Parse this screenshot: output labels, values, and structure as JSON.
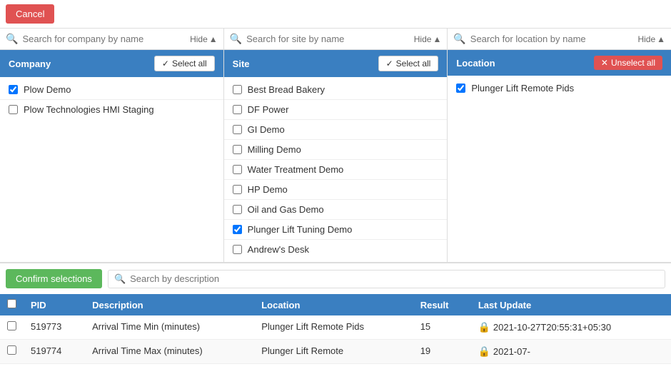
{
  "cancelButton": "Cancel",
  "searchBars": [
    {
      "placeholder": "Search for company by name",
      "hideLabel": "Hide"
    },
    {
      "placeholder": "Search for site by name",
      "hideLabel": "Hide"
    },
    {
      "placeholder": "Search for location by name",
      "hideLabel": "Hide"
    }
  ],
  "columns": [
    {
      "header": "Company",
      "selectAllLabel": "Select all",
      "items": [
        {
          "label": "Plow Demo",
          "checked": true
        },
        {
          "label": "Plow Technologies HMI Staging",
          "checked": false
        }
      ]
    },
    {
      "header": "Site",
      "selectAllLabel": "Select all",
      "items": [
        {
          "label": "Best Bread Bakery",
          "checked": false
        },
        {
          "label": "DF Power",
          "checked": false
        },
        {
          "label": "GI Demo",
          "checked": false
        },
        {
          "label": "Milling Demo",
          "checked": false
        },
        {
          "label": "Water Treatment Demo",
          "checked": false
        },
        {
          "label": "HP Demo",
          "checked": false
        },
        {
          "label": "Oil and Gas Demo",
          "checked": false
        },
        {
          "label": "Plunger Lift Tuning Demo",
          "checked": true
        },
        {
          "label": "Andrew's Desk",
          "checked": false
        }
      ]
    },
    {
      "header": "Location",
      "unselectAllLabel": "Unselect all",
      "items": [
        {
          "label": "Plunger Lift Remote Pids",
          "checked": true
        }
      ]
    }
  ],
  "confirmButton": "Confirm selections",
  "descSearchPlaceholder": "Search by description",
  "tableHeaders": [
    "",
    "PID",
    "Description",
    "Location",
    "Result",
    "Last Update"
  ],
  "tableRows": [
    {
      "pid": "519773",
      "description": "Arrival Time Min (minutes)",
      "location": "Plunger Lift Remote Pids",
      "result": "15",
      "lastUpdate": "2021-10-27T20:55:31+05:30"
    },
    {
      "pid": "519774",
      "description": "Arrival Time Max (minutes)",
      "location": "Plunger Lift Remote",
      "result": "19",
      "lastUpdate": "2021-07-"
    }
  ]
}
